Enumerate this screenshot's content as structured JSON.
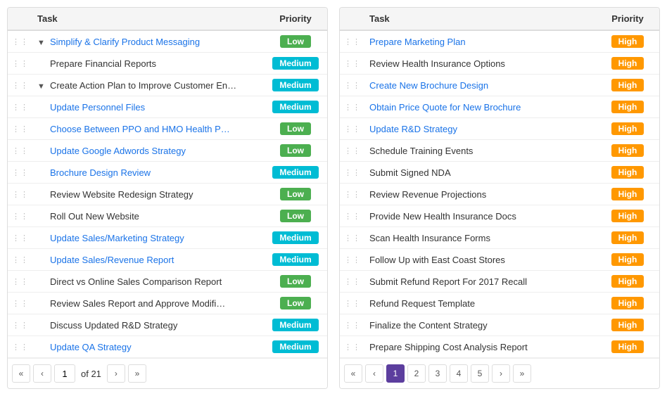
{
  "left_table": {
    "headers": [
      "",
      "Task",
      "Priority"
    ],
    "rows": [
      {
        "drag": true,
        "indent": 0,
        "toggle": "▼",
        "name": "Simplify & Clarify Product Messaging",
        "link": true,
        "priority": "Low",
        "badge": "low"
      },
      {
        "drag": true,
        "indent": 1,
        "toggle": "",
        "name": "Prepare Financial Reports",
        "link": false,
        "priority": "Medium",
        "badge": "medium"
      },
      {
        "drag": true,
        "indent": 0,
        "toggle": "▼",
        "name": "Create Action Plan to Improve Customer En…",
        "link": false,
        "priority": "Medium",
        "badge": "medium"
      },
      {
        "drag": true,
        "indent": 1,
        "toggle": "",
        "name": "Update Personnel Files",
        "link": true,
        "priority": "Medium",
        "badge": "medium"
      },
      {
        "drag": true,
        "indent": 1,
        "toggle": "",
        "name": "Choose Between PPO and HMO Health P…",
        "link": true,
        "priority": "Low",
        "badge": "low"
      },
      {
        "drag": true,
        "indent": 1,
        "toggle": "",
        "name": "Update Google Adwords Strategy",
        "link": true,
        "priority": "Low",
        "badge": "low"
      },
      {
        "drag": true,
        "indent": 1,
        "toggle": "",
        "name": "Brochure Design Review",
        "link": true,
        "priority": "Medium",
        "badge": "medium"
      },
      {
        "drag": true,
        "indent": 1,
        "toggle": "",
        "name": "Review Website Redesign Strategy",
        "link": false,
        "priority": "Low",
        "badge": "low"
      },
      {
        "drag": true,
        "indent": 1,
        "toggle": "",
        "name": "Roll Out New Website",
        "link": false,
        "priority": "Low",
        "badge": "low"
      },
      {
        "drag": true,
        "indent": 1,
        "toggle": "",
        "name": "Update Sales/Marketing Strategy",
        "link": true,
        "priority": "Medium",
        "badge": "medium"
      },
      {
        "drag": true,
        "indent": 1,
        "toggle": "",
        "name": "Update Sales/Revenue Report",
        "link": true,
        "priority": "Medium",
        "badge": "medium"
      },
      {
        "drag": true,
        "indent": 1,
        "toggle": "",
        "name": "Direct vs Online Sales Comparison Report",
        "link": false,
        "priority": "Low",
        "badge": "low"
      },
      {
        "drag": true,
        "indent": 1,
        "toggle": "",
        "name": "Review Sales Report and Approve Modifi…",
        "link": false,
        "priority": "Low",
        "badge": "low"
      },
      {
        "drag": true,
        "indent": 1,
        "toggle": "",
        "name": "Discuss Updated R&D Strategy",
        "link": false,
        "priority": "Medium",
        "badge": "medium"
      },
      {
        "drag": true,
        "indent": 1,
        "toggle": "",
        "name": "Update QA Strategy",
        "link": true,
        "priority": "Medium",
        "badge": "medium"
      }
    ],
    "pagination": {
      "current": 1,
      "total": 21,
      "pages": []
    }
  },
  "right_table": {
    "headers": [
      "",
      "Task",
      "Priority"
    ],
    "rows": [
      {
        "drag": true,
        "name": "Prepare Marketing Plan",
        "link": true,
        "priority": "High",
        "badge": "high"
      },
      {
        "drag": true,
        "name": "Review Health Insurance Options",
        "link": false,
        "priority": "High",
        "badge": "high"
      },
      {
        "drag": true,
        "name": "Create New Brochure Design",
        "link": true,
        "priority": "High",
        "badge": "high"
      },
      {
        "drag": true,
        "name": "Obtain Price Quote for New Brochure",
        "link": true,
        "priority": "High",
        "badge": "high"
      },
      {
        "drag": true,
        "name": "Update R&D Strategy",
        "link": true,
        "priority": "High",
        "badge": "high"
      },
      {
        "drag": true,
        "name": "Schedule Training Events",
        "link": false,
        "priority": "High",
        "badge": "high"
      },
      {
        "drag": true,
        "name": "Submit Signed NDA",
        "link": false,
        "priority": "High",
        "badge": "high"
      },
      {
        "drag": true,
        "name": "Review Revenue Projections",
        "link": false,
        "priority": "High",
        "badge": "high"
      },
      {
        "drag": true,
        "name": "Provide New Health Insurance Docs",
        "link": false,
        "priority": "High",
        "badge": "high"
      },
      {
        "drag": true,
        "name": "Scan Health Insurance Forms",
        "link": false,
        "priority": "High",
        "badge": "high"
      },
      {
        "drag": true,
        "name": "Follow Up with East Coast Stores",
        "link": false,
        "priority": "High",
        "badge": "high"
      },
      {
        "drag": true,
        "name": "Submit Refund Report For 2017 Recall",
        "link": false,
        "priority": "High",
        "badge": "high"
      },
      {
        "drag": true,
        "name": "Refund Request Template",
        "link": false,
        "priority": "High",
        "badge": "high"
      },
      {
        "drag": true,
        "name": "Finalize the Content Strategy",
        "link": false,
        "priority": "High",
        "badge": "high"
      },
      {
        "drag": true,
        "name": "Prepare Shipping Cost Analysis Report",
        "link": false,
        "priority": "High",
        "badge": "high"
      }
    ],
    "pagination": {
      "current": 1,
      "pages": [
        1,
        2,
        3,
        4,
        5
      ]
    }
  },
  "icons": {
    "drag": "⋮⋮",
    "first": "«",
    "prev": "‹",
    "next": "›",
    "last": "»"
  }
}
